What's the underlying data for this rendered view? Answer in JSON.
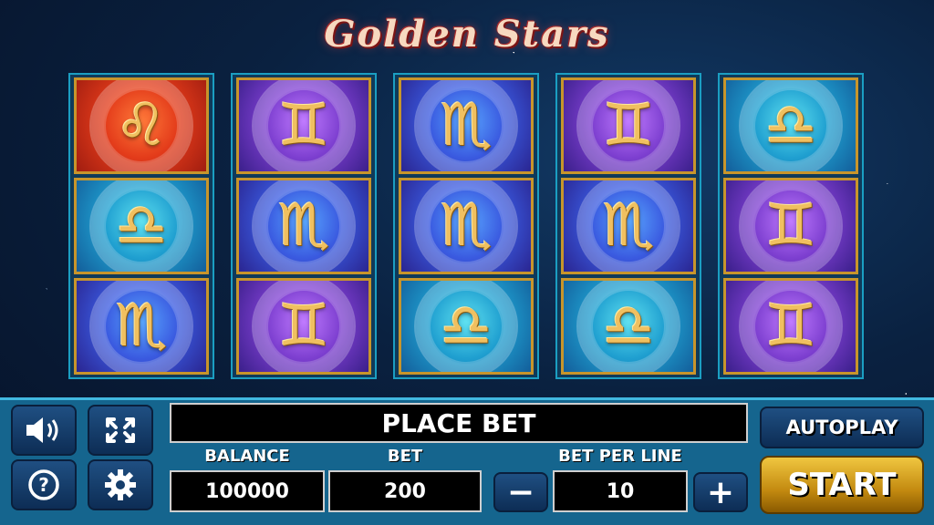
{
  "title": "Golden Stars",
  "reels": [
    [
      "leo",
      "libra",
      "scorpio"
    ],
    [
      "gemini",
      "scorpio",
      "gemini"
    ],
    [
      "scorpio",
      "scorpio",
      "libra"
    ],
    [
      "gemini",
      "scorpio",
      "libra"
    ],
    [
      "libra",
      "gemini",
      "gemini"
    ]
  ],
  "symbols": {
    "leo": "♌",
    "gemini": "♊",
    "scorpio": "♏",
    "libra": "♎"
  },
  "status_text": "PLACE BET",
  "balance": {
    "label": "BALANCE",
    "value": "100000"
  },
  "bet": {
    "label": "BET",
    "value": "200"
  },
  "bet_per_line": {
    "label": "BET PER LINE",
    "value": "10",
    "minus": "−",
    "plus": "+"
  },
  "buttons": {
    "autoplay": "AUTOPLAY",
    "start": "START"
  },
  "icons": [
    "speaker-icon",
    "fullscreen-icon",
    "help-icon",
    "gear-icon"
  ]
}
